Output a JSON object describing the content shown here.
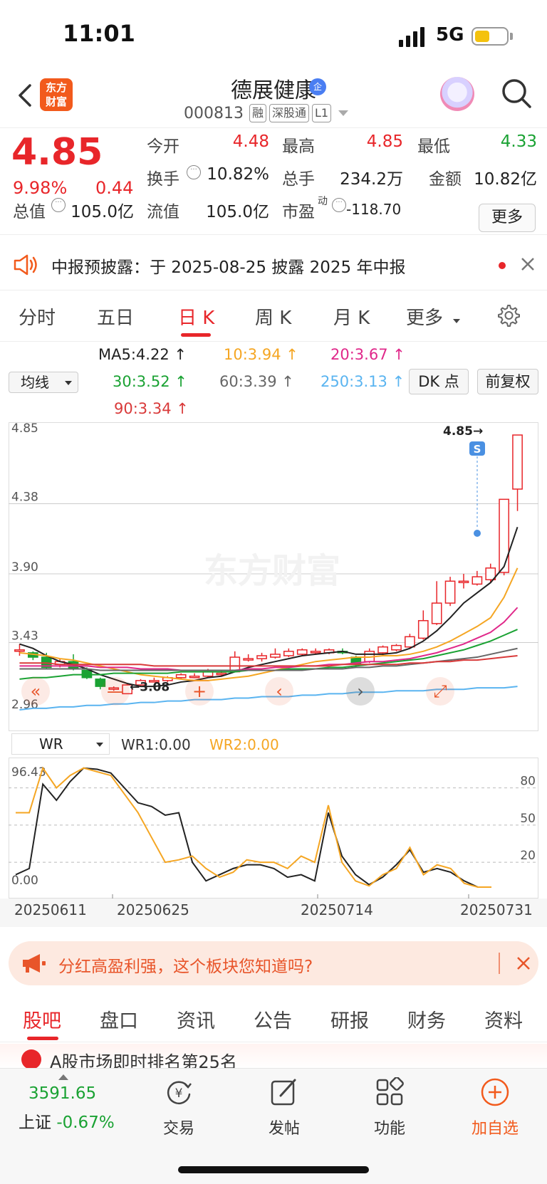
{
  "status_bar": {
    "time": "11:01",
    "network": "5G"
  },
  "header": {
    "logo_text_1": "东方",
    "logo_text_2": "财富",
    "stock_name": "德展健康",
    "verified_badge": "企",
    "code": "000813",
    "tags": [
      "融",
      "深股通",
      "L1"
    ]
  },
  "quote": {
    "price": "4.85",
    "change_pct": "9.98%",
    "change_amt": "0.44",
    "fields": {
      "open_label": "今开",
      "open": "4.48",
      "high_label": "最高",
      "high": "4.85",
      "low_label": "最低",
      "low": "4.33",
      "turnover_label": "换手",
      "turnover": "10.82%",
      "volume_label": "总手",
      "volume": "234.2万",
      "amount_label": "金额",
      "amount": "10.82亿",
      "mcap_label": "总值",
      "mcap": "105.0亿",
      "float_label": "流值",
      "float_cap": "105.0亿",
      "pe_label": "市盈",
      "pe_sup": "动",
      "pe": "-118.70"
    },
    "more_label": "更多"
  },
  "notice": {
    "text": "中报预披露：于 2025-08-25 披露 2025 年中报"
  },
  "k_tabs": {
    "items": [
      "分时",
      "五日",
      "日 K",
      "周 K",
      "月 K",
      "更多"
    ],
    "active": "日 K"
  },
  "ma": {
    "select_label": "均线",
    "items": [
      {
        "label": "MA5:4.22",
        "color": "#222222"
      },
      {
        "label": "10:3.94",
        "color": "#f5a623"
      },
      {
        "label": "20:3.67",
        "color": "#e0288a"
      },
      {
        "label": "30:3.52",
        "color": "#1aa233"
      },
      {
        "label": "60:3.39",
        "color": "#666666"
      },
      {
        "label": "250:3.13",
        "color": "#5ab4f0"
      },
      {
        "label": "90:3.34",
        "color": "#d93a3a"
      }
    ],
    "dk_label": "DK 点",
    "fq_label": "前复权"
  },
  "chart_data": [
    {
      "type": "candlestick",
      "ylim": [
        2.96,
        4.85
      ],
      "y_ticks": [
        "4.85",
        "4.38",
        "3.90",
        "3.43",
        "2.96"
      ],
      "max_label": "4.85",
      "min_label": "3.08",
      "watermark": "东方财富",
      "marker_label": "S",
      "candles": [
        {
          "o": 3.38,
          "c": 3.38,
          "h": 3.42,
          "l": 3.34
        },
        {
          "o": 3.36,
          "c": 3.33,
          "h": 3.37,
          "l": 3.31
        },
        {
          "o": 3.33,
          "c": 3.26,
          "h": 3.36,
          "l": 3.25
        },
        {
          "o": 3.28,
          "c": 3.3,
          "h": 3.32,
          "l": 3.26
        },
        {
          "o": 3.3,
          "c": 3.25,
          "h": 3.35,
          "l": 3.24
        },
        {
          "o": 3.24,
          "c": 3.19,
          "h": 3.26,
          "l": 3.18
        },
        {
          "o": 3.18,
          "c": 3.13,
          "h": 3.19,
          "l": 3.11
        },
        {
          "o": 3.12,
          "c": 3.12,
          "h": 3.13,
          "l": 3.1
        },
        {
          "o": 3.08,
          "c": 3.14,
          "h": 3.15,
          "l": 3.08
        },
        {
          "o": 3.14,
          "c": 3.17,
          "h": 3.18,
          "l": 3.13
        },
        {
          "o": 3.17,
          "c": 3.17,
          "h": 3.19,
          "l": 3.16
        },
        {
          "o": 3.17,
          "c": 3.19,
          "h": 3.2,
          "l": 3.16
        },
        {
          "o": 3.19,
          "c": 3.21,
          "h": 3.22,
          "l": 3.18
        },
        {
          "o": 3.2,
          "c": 3.2,
          "h": 3.22,
          "l": 3.19
        },
        {
          "o": 3.2,
          "c": 3.23,
          "h": 3.25,
          "l": 3.19
        },
        {
          "o": 3.22,
          "c": 3.22,
          "h": 3.24,
          "l": 3.2
        },
        {
          "o": 3.23,
          "c": 3.33,
          "h": 3.37,
          "l": 3.23
        },
        {
          "o": 3.32,
          "c": 3.32,
          "h": 3.35,
          "l": 3.3
        },
        {
          "o": 3.32,
          "c": 3.34,
          "h": 3.36,
          "l": 3.3
        },
        {
          "o": 3.33,
          "c": 3.35,
          "h": 3.39,
          "l": 3.32
        },
        {
          "o": 3.34,
          "c": 3.37,
          "h": 3.39,
          "l": 3.33
        },
        {
          "o": 3.35,
          "c": 3.38,
          "h": 3.39,
          "l": 3.34
        },
        {
          "o": 3.37,
          "c": 3.37,
          "h": 3.39,
          "l": 3.35
        },
        {
          "o": 3.36,
          "c": 3.38,
          "h": 3.39,
          "l": 3.35
        },
        {
          "o": 3.37,
          "c": 3.36,
          "h": 3.39,
          "l": 3.35
        },
        {
          "o": 3.33,
          "c": 3.28,
          "h": 3.34,
          "l": 3.26
        },
        {
          "o": 3.3,
          "c": 3.37,
          "h": 3.39,
          "l": 3.29
        },
        {
          "o": 3.36,
          "c": 3.4,
          "h": 3.41,
          "l": 3.34
        },
        {
          "o": 3.38,
          "c": 3.41,
          "h": 3.42,
          "l": 3.37
        },
        {
          "o": 3.4,
          "c": 3.47,
          "h": 3.49,
          "l": 3.39
        },
        {
          "o": 3.46,
          "c": 3.58,
          "h": 3.65,
          "l": 3.45
        },
        {
          "o": 3.56,
          "c": 3.7,
          "h": 3.85,
          "l": 3.55
        },
        {
          "o": 3.7,
          "c": 3.85,
          "h": 3.88,
          "l": 3.68
        },
        {
          "o": 3.85,
          "c": 3.85,
          "h": 3.9,
          "l": 3.8
        },
        {
          "o": 3.83,
          "c": 3.88,
          "h": 3.92,
          "l": 3.82
        },
        {
          "o": 3.86,
          "c": 3.94,
          "h": 3.97,
          "l": 3.84
        },
        {
          "o": 3.91,
          "c": 4.41,
          "h": 4.41,
          "l": 3.89
        },
        {
          "o": 4.48,
          "c": 4.85,
          "h": 4.85,
          "l": 4.33
        }
      ],
      "series": [
        {
          "name": "MA5",
          "color": "#222222",
          "values": [
            3.42,
            3.39,
            3.34,
            3.3,
            3.28,
            3.25,
            3.21,
            3.18,
            3.15,
            3.13,
            3.13,
            3.14,
            3.16,
            3.17,
            3.19,
            3.2,
            3.23,
            3.26,
            3.28,
            3.3,
            3.32,
            3.34,
            3.35,
            3.36,
            3.37,
            3.35,
            3.35,
            3.35,
            3.36,
            3.39,
            3.44,
            3.51,
            3.6,
            3.7,
            3.77,
            3.84,
            3.95,
            4.22
          ]
        },
        {
          "name": "10",
          "color": "#f5a623",
          "values": [
            3.36,
            3.35,
            3.34,
            3.32,
            3.31,
            3.29,
            3.27,
            3.25,
            3.23,
            3.21,
            3.2,
            3.19,
            3.18,
            3.17,
            3.17,
            3.18,
            3.19,
            3.2,
            3.22,
            3.24,
            3.26,
            3.28,
            3.3,
            3.31,
            3.32,
            3.33,
            3.33,
            3.34,
            3.34,
            3.35,
            3.37,
            3.4,
            3.44,
            3.49,
            3.54,
            3.6,
            3.74,
            3.94
          ]
        },
        {
          "name": "20",
          "color": "#e0288a",
          "values": [
            3.27,
            3.27,
            3.27,
            3.27,
            3.27,
            3.27,
            3.26,
            3.26,
            3.26,
            3.25,
            3.25,
            3.25,
            3.24,
            3.24,
            3.24,
            3.24,
            3.24,
            3.25,
            3.25,
            3.26,
            3.26,
            3.27,
            3.27,
            3.28,
            3.28,
            3.29,
            3.3,
            3.3,
            3.31,
            3.32,
            3.34,
            3.36,
            3.39,
            3.42,
            3.46,
            3.5,
            3.57,
            3.67
          ]
        },
        {
          "name": "30",
          "color": "#1aa233",
          "values": [
            3.18,
            3.19,
            3.19,
            3.2,
            3.21,
            3.21,
            3.21,
            3.22,
            3.22,
            3.22,
            3.22,
            3.22,
            3.23,
            3.23,
            3.23,
            3.23,
            3.23,
            3.24,
            3.24,
            3.24,
            3.25,
            3.25,
            3.25,
            3.26,
            3.26,
            3.27,
            3.28,
            3.29,
            3.3,
            3.31,
            3.32,
            3.34,
            3.36,
            3.38,
            3.41,
            3.44,
            3.48,
            3.52
          ]
        },
        {
          "name": "60",
          "color": "#666666",
          "values": [
            3.25,
            3.25,
            3.25,
            3.25,
            3.25,
            3.25,
            3.24,
            3.24,
            3.24,
            3.24,
            3.24,
            3.24,
            3.24,
            3.24,
            3.24,
            3.24,
            3.24,
            3.24,
            3.24,
            3.24,
            3.24,
            3.24,
            3.25,
            3.25,
            3.25,
            3.26,
            3.26,
            3.27,
            3.27,
            3.28,
            3.29,
            3.3,
            3.31,
            3.32,
            3.33,
            3.35,
            3.37,
            3.39
          ]
        },
        {
          "name": "250",
          "color": "#5ab4f0",
          "values": [
            2.97,
            2.98,
            2.98,
            2.99,
            2.99,
            3.0,
            3.0,
            3.01,
            3.01,
            3.02,
            3.02,
            3.03,
            3.03,
            3.04,
            3.04,
            3.04,
            3.05,
            3.05,
            3.06,
            3.06,
            3.06,
            3.07,
            3.07,
            3.08,
            3.08,
            3.09,
            3.09,
            3.09,
            3.1,
            3.1,
            3.1,
            3.11,
            3.11,
            3.11,
            3.12,
            3.12,
            3.12,
            3.13
          ]
        },
        {
          "name": "90",
          "color": "#d93a3a",
          "values": [
            3.29,
            3.29,
            3.29,
            3.28,
            3.28,
            3.28,
            3.28,
            3.28,
            3.28,
            3.28,
            3.27,
            3.27,
            3.27,
            3.27,
            3.27,
            3.27,
            3.27,
            3.27,
            3.27,
            3.27,
            3.27,
            3.27,
            3.27,
            3.27,
            3.28,
            3.28,
            3.28,
            3.28,
            3.28,
            3.29,
            3.29,
            3.3,
            3.3,
            3.31,
            3.31,
            3.32,
            3.33,
            3.34
          ]
        }
      ]
    },
    {
      "type": "line",
      "ylim": [
        0,
        96.43
      ],
      "y_ticks": [
        "96.43",
        "0.00"
      ],
      "right_ticks": [
        "80",
        "50",
        "20"
      ],
      "series": [
        {
          "name": "WR1",
          "color": "#222222",
          "values": [
            10,
            15,
            83,
            70,
            85,
            96,
            95,
            92,
            80,
            68,
            65,
            58,
            60,
            20,
            5,
            10,
            15,
            18,
            18,
            15,
            8,
            10,
            5,
            60,
            25,
            10,
            2,
            8,
            18,
            30,
            12,
            15,
            12,
            5,
            0,
            0
          ]
        },
        {
          "name": "WR2",
          "color": "#f5a623",
          "values": [
            60,
            60,
            96,
            80,
            90,
            96,
            93,
            90,
            75,
            60,
            40,
            20,
            22,
            25,
            15,
            8,
            12,
            22,
            20,
            20,
            15,
            25,
            20,
            66,
            20,
            5,
            1,
            10,
            15,
            32,
            10,
            18,
            15,
            3,
            0,
            0
          ]
        }
      ],
      "categories": [
        "20250611",
        "20250625",
        "20250714",
        "20250731"
      ]
    }
  ],
  "wr": {
    "select_label": "WR",
    "wr1_label": "WR1:0.00",
    "wr2_label": "WR2:0.00"
  },
  "promo": {
    "text": "分红高盈利强，这个板块您知道吗?"
  },
  "bottom_tabs": {
    "items": [
      "股吧",
      "盘口",
      "资讯",
      "公告",
      "研报",
      "财务",
      "资料"
    ],
    "active": "股吧"
  },
  "peek_text": "A股市场即时排名第25名",
  "bottom_nav": {
    "index_value": "3591.65",
    "index_name": "上证",
    "index_change": "-0.67%",
    "items": [
      "交易",
      "发帖",
      "功能",
      "加自选"
    ]
  }
}
